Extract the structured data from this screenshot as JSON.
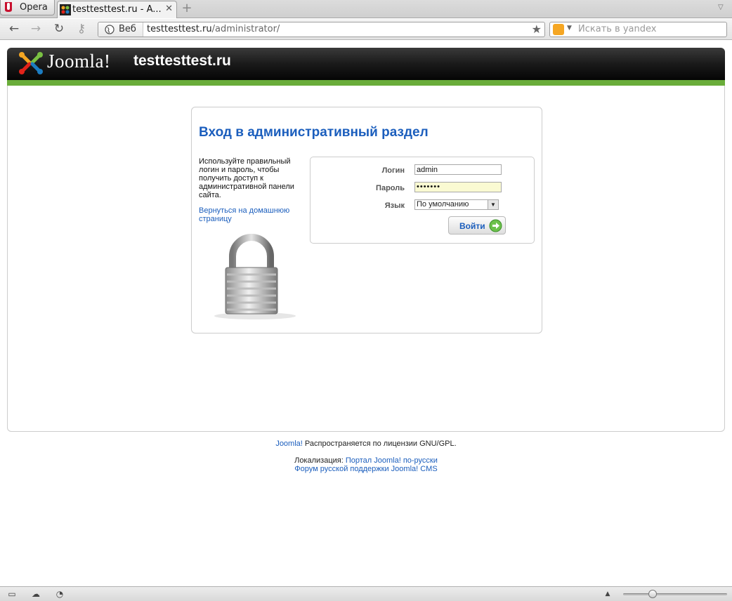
{
  "browser": {
    "menu_label": "Opera",
    "tab_title": "testtesttest.ru - A...",
    "address": {
      "badge": "Веб",
      "host": "testtesttest.ru",
      "path": "/administrator/"
    },
    "search_placeholder": "Искать в yandex"
  },
  "header": {
    "logo_text": "Joomla!",
    "site_name": "testtesttest.ru"
  },
  "login": {
    "title": "Вход в административный раздел",
    "description": "Используйте правильный логин и пароль, чтобы получить доступ к административной панели сайта.",
    "home_link": "Вернуться на домашнюю страницу",
    "username_label": "Логин",
    "username_value": "admin",
    "password_label": "Пароль",
    "password_value": "•••••••",
    "language_label": "Язык",
    "language_value": "По умолчанию",
    "submit_label": "Войти"
  },
  "footer": {
    "joomla_link": "Joomla!",
    "license_text": " Распространяется по лицензии GNU/GPL.",
    "localization_label": "Локализация: ",
    "portal_link": "Портал Joomla! по-русски",
    "forum_link": "Форум русской поддержки Joomla! CMS"
  },
  "colors": {
    "link": "#1b5ebd",
    "header_bar": "#6aad3a"
  }
}
